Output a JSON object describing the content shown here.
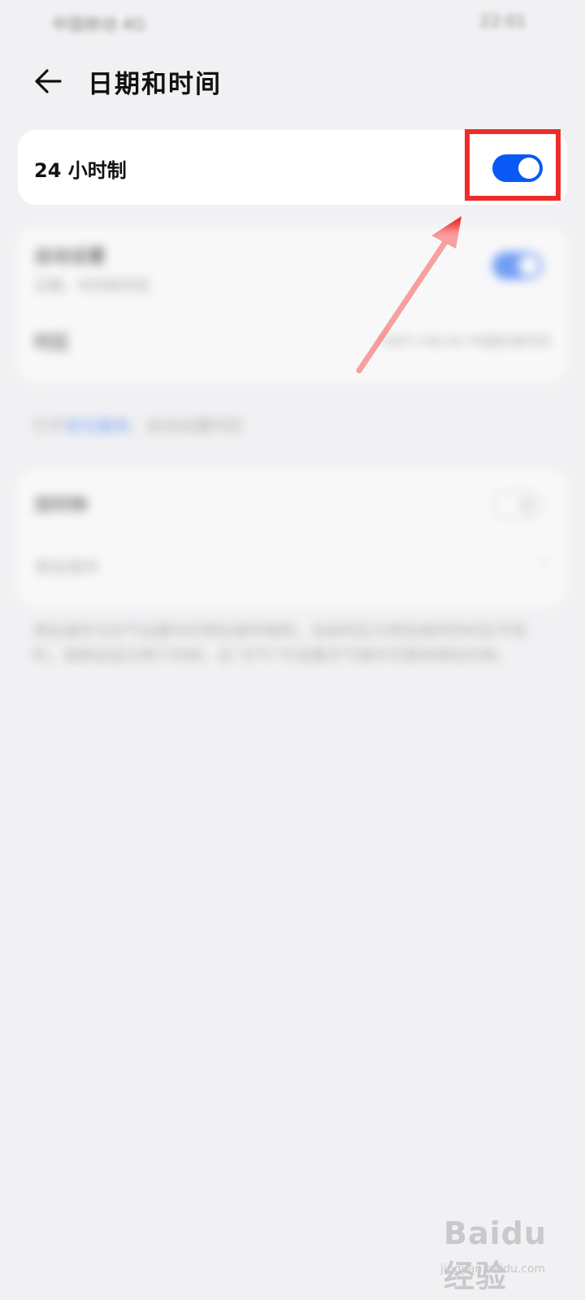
{
  "status_bar": {
    "left_text": "中国移动 4G",
    "right_text": "22:01"
  },
  "header": {
    "title": "日期和时间"
  },
  "time_format": {
    "label": "24 小时制",
    "toggle_state": "on"
  },
  "auto_settings": {
    "title": "自动设置",
    "subtitle": "日期、时间和时区",
    "toggle_state": "on",
    "timezone_label": "时区",
    "timezone_value": "GMT+08:00 中国标准时间"
  },
  "location_note": {
    "prefix": "打开",
    "link": "定位服务",
    "suffix": "，自动设置时区"
  },
  "dual_clock": {
    "label": "双时钟",
    "toggle_state": "off",
    "city_label": "常驻城市",
    "chevron": "›"
  },
  "dual_clock_note": "常驻城市与天气设置中的常驻城市相同，当前时区与常驻城市的时区不同时，锁屏会显示两个时钟，在“天气”中设置天气城市可更改常驻时钟。",
  "colors": {
    "accent": "#0a59f7",
    "highlight": "#ee2d2a",
    "background": "#f1f1f3"
  },
  "watermark": {
    "brand": "Baidu 经验",
    "url": "jingyan.baidu.com"
  }
}
